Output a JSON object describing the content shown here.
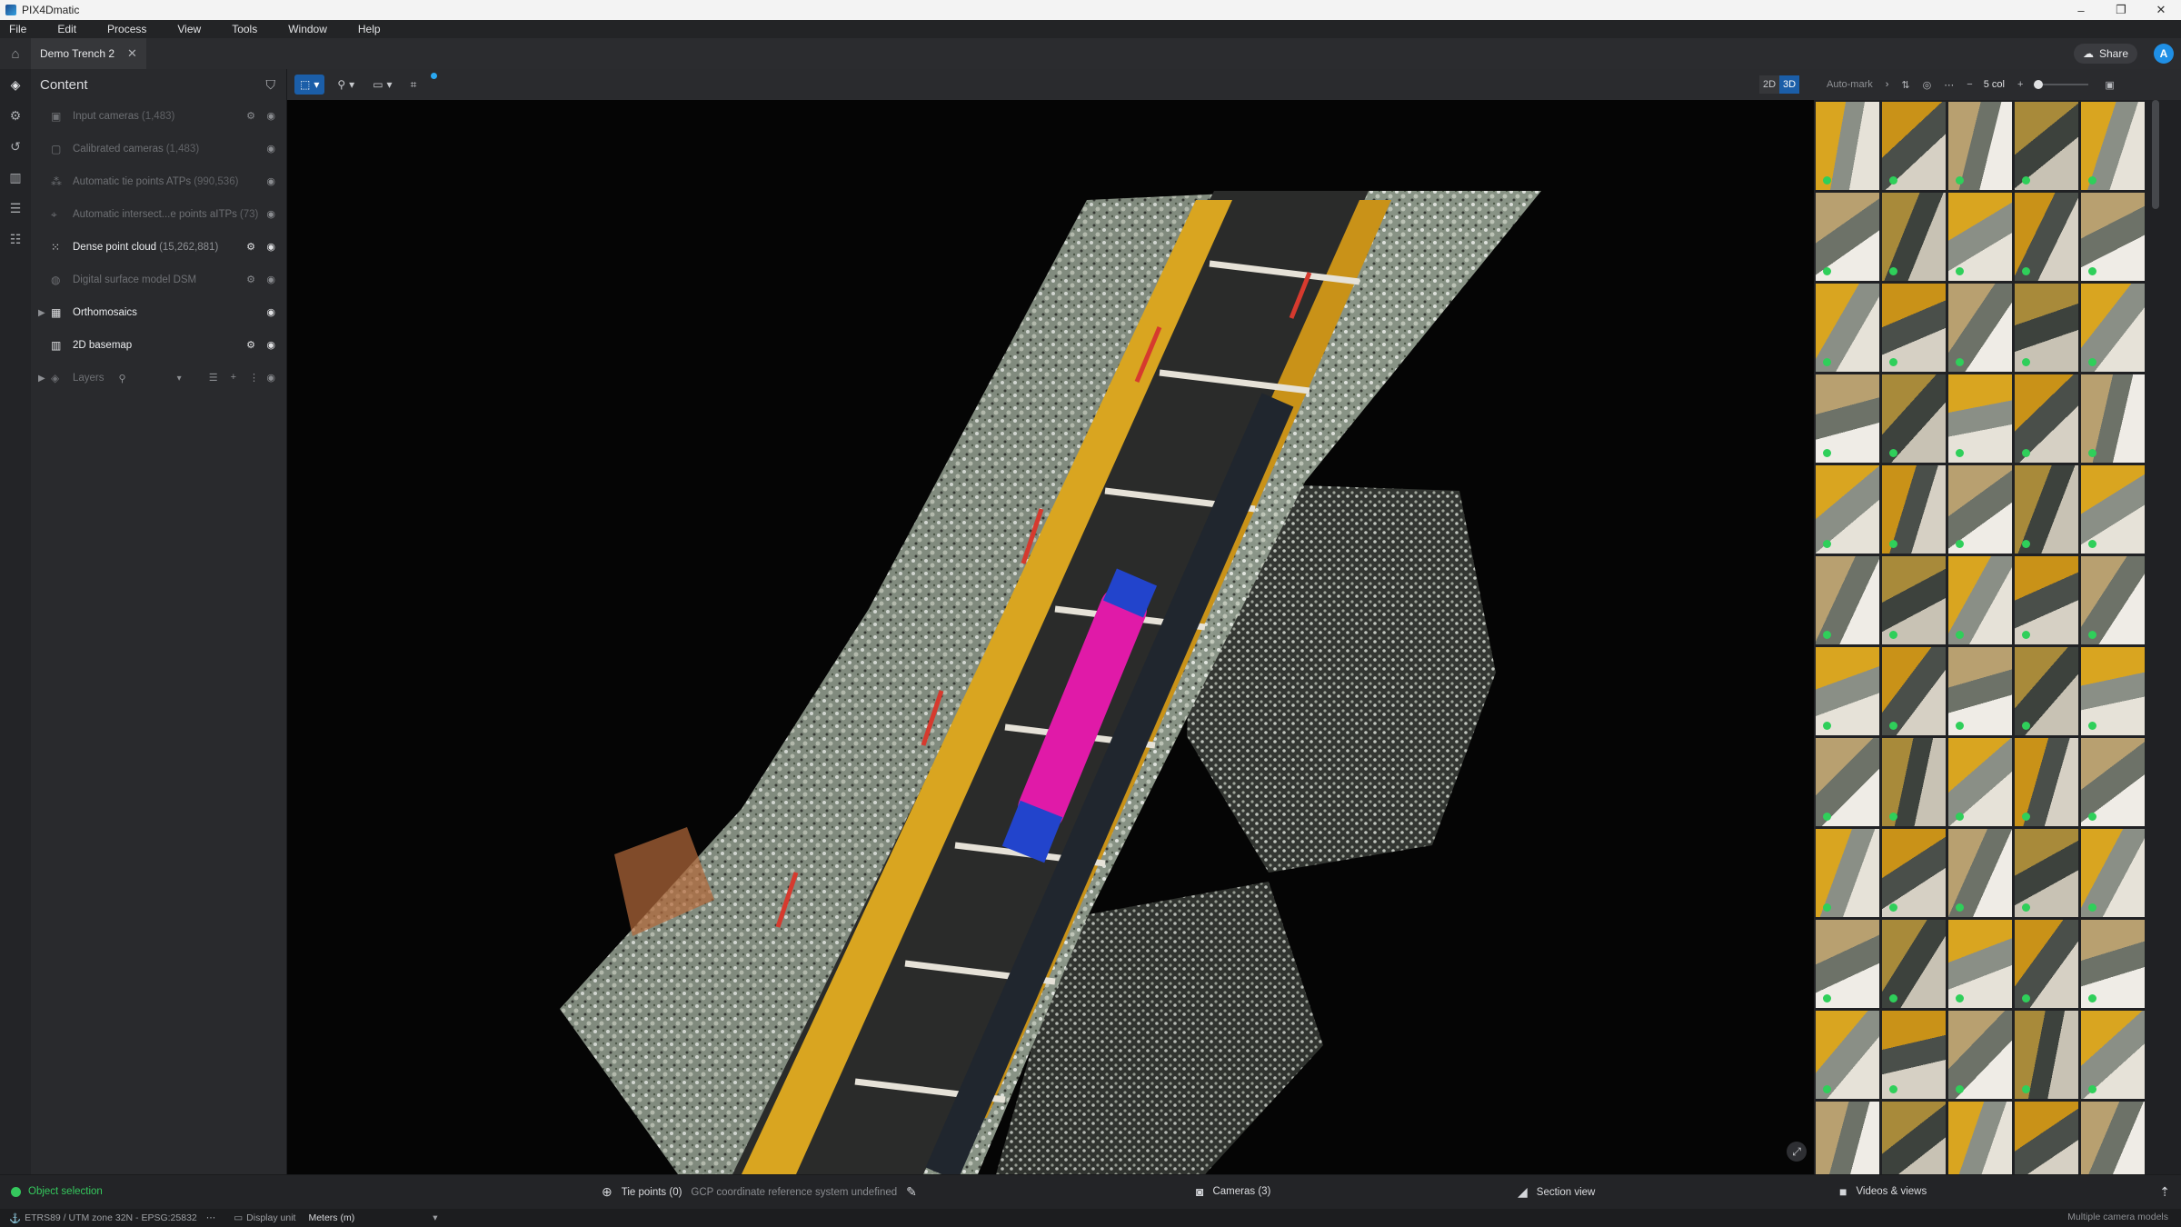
{
  "window": {
    "title": "PIX4Dmatic",
    "minimize": "–",
    "maximize": "❐",
    "close": "✕"
  },
  "menu": [
    "File",
    "Edit",
    "Process",
    "View",
    "Tools",
    "Window",
    "Help"
  ],
  "tabs": {
    "home_icon": "home-icon",
    "document": "Demo Trench 2",
    "close": "✕"
  },
  "header": {
    "share_label": "Share",
    "avatar_initial": "A"
  },
  "content_panel": {
    "title": "Content",
    "layers": [
      {
        "name": "Input cameras",
        "count": "(1,483)",
        "state": "dim"
      },
      {
        "name": "Calibrated cameras",
        "count": "(1,483)",
        "state": "dim"
      },
      {
        "name": "Automatic tie points ATPs",
        "count": "(990,536)",
        "state": "dim"
      },
      {
        "name": "Automatic intersect...e points aITPs",
        "count": "(73)",
        "state": "dim"
      },
      {
        "name": "Dense point cloud",
        "count": "(15,262,881)",
        "state": "bright"
      },
      {
        "name": "Digital surface model DSM",
        "count": "",
        "state": "dim"
      },
      {
        "name": "Orthomosaics",
        "count": "",
        "state": "bright"
      },
      {
        "name": "2D basemap",
        "count": "",
        "state": "bright"
      },
      {
        "name": "Layers",
        "count": "",
        "state": "dim"
      }
    ]
  },
  "viewport_toolbar": {
    "mode_2d": "2D",
    "mode_3d": "3D",
    "selected_mode": "3D"
  },
  "camera_panel": {
    "automark_label": "Auto-mark",
    "columns_label": "5 col",
    "columns": 5,
    "thumbnail_count": 60
  },
  "bottom_bar": {
    "object_selection": "Object selection",
    "tie_points": "Tie points (0)",
    "gcp_message": "GCP coordinate reference system undefined",
    "cameras": "Cameras (3)",
    "section_view": "Section view",
    "videos_views": "Videos & views"
  },
  "status_bar": {
    "crs": "ETRS89 / UTM zone 32N - EPSG:25832",
    "display_unit_label": "Display unit",
    "display_unit_value": "Meters (m)",
    "camera_models": "Multiple camera models"
  },
  "colors": {
    "accent": "#1b5ea8",
    "badge": "#2aa8f2",
    "ok_green": "#35c85d",
    "shoring_yellow": "#d9a520",
    "pipe_magenta": "#e01aa8",
    "pipe_blue": "#2244cc"
  }
}
